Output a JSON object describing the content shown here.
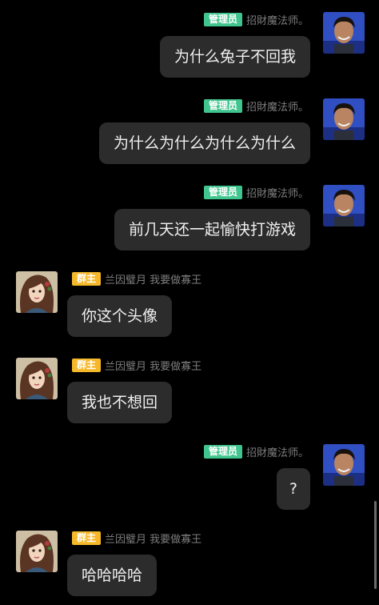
{
  "messages": [
    {
      "side": "right",
      "badge": "管理员",
      "badge_type": "admin",
      "nick": "招財魔法师。",
      "text": "为什么兔子不回我",
      "avatar": "man-avatar"
    },
    {
      "side": "right",
      "badge": "管理员",
      "badge_type": "admin",
      "nick": "招財魔法师。",
      "text": "为什么为什么为什么为什么",
      "avatar": "man-avatar"
    },
    {
      "side": "right",
      "badge": "管理员",
      "badge_type": "admin",
      "nick": "招財魔法师。",
      "text": "前几天还一起愉快打游戏",
      "avatar": "man-avatar"
    },
    {
      "side": "left",
      "badge": "群主",
      "badge_type": "owner",
      "nick": "兰因璧月  我要做寡王",
      "text": "你这个头像",
      "avatar": "girl-avatar"
    },
    {
      "side": "left",
      "badge": "群主",
      "badge_type": "owner",
      "nick": "兰因璧月  我要做寡王",
      "text": "我也不想回",
      "avatar": "girl-avatar"
    },
    {
      "side": "right",
      "badge": "管理员",
      "badge_type": "admin",
      "nick": "招財魔法师。",
      "text": "?",
      "avatar": "man-avatar"
    },
    {
      "side": "left",
      "badge": "群主",
      "badge_type": "owner",
      "nick": "兰因璧月  我要做寡王",
      "text": "哈哈哈哈",
      "avatar": "girl-avatar"
    }
  ],
  "colors": {
    "background": "#000000",
    "bubble": "#2c2c2c",
    "admin_badge": "#41c58e",
    "owner_badge": "#f5b82a"
  }
}
